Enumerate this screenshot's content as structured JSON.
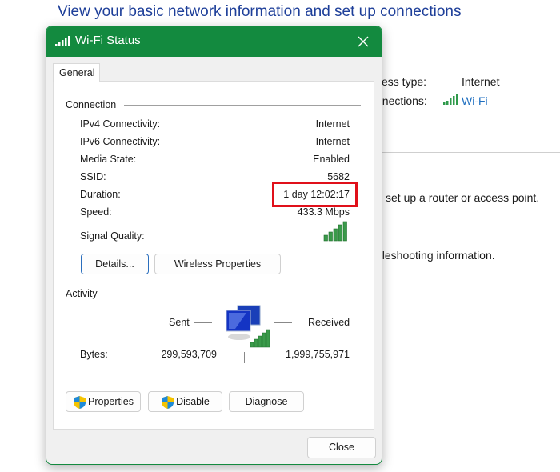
{
  "background": {
    "title": "View your basic network information and set up connections",
    "access_type_label": "cess type:",
    "access_type_value": "Internet",
    "connections_label": "nnections:",
    "connections_value": "Wi-Fi",
    "router_text": "set up a router or access point.",
    "troubleshoot_text": "bleshooting information."
  },
  "dialog": {
    "title": "Wi-Fi Status",
    "tab": "General",
    "connection": {
      "heading": "Connection",
      "rows": [
        {
          "label": "IPv4 Connectivity:",
          "value": "Internet"
        },
        {
          "label": "IPv6 Connectivity:",
          "value": "Internet"
        },
        {
          "label": "Media State:",
          "value": "Enabled"
        },
        {
          "label": "SSID:",
          "value": "5682"
        },
        {
          "label": "Duration:",
          "value": "1 day 12:02:17"
        },
        {
          "label": "Speed:",
          "value": "433.3 Mbps"
        }
      ],
      "signal_label": "Signal Quality:",
      "signal_bars": 5,
      "signal_max": 5
    },
    "details_button": "Details...",
    "wireless_button": "Wireless Properties",
    "activity": {
      "heading": "Activity",
      "sent": "Sent",
      "received": "Received",
      "bytes_label": "Bytes:",
      "bytes_sent": "299,593,709",
      "bytes_received": "1,999,755,971"
    },
    "properties_button": "Properties",
    "disable_button": "Disable",
    "diagnose_button": "Diagnose",
    "close_button": "Close"
  },
  "colors": {
    "accent": "#138a3f",
    "highlight": "#e0101a",
    "link": "#1f6fc0"
  }
}
